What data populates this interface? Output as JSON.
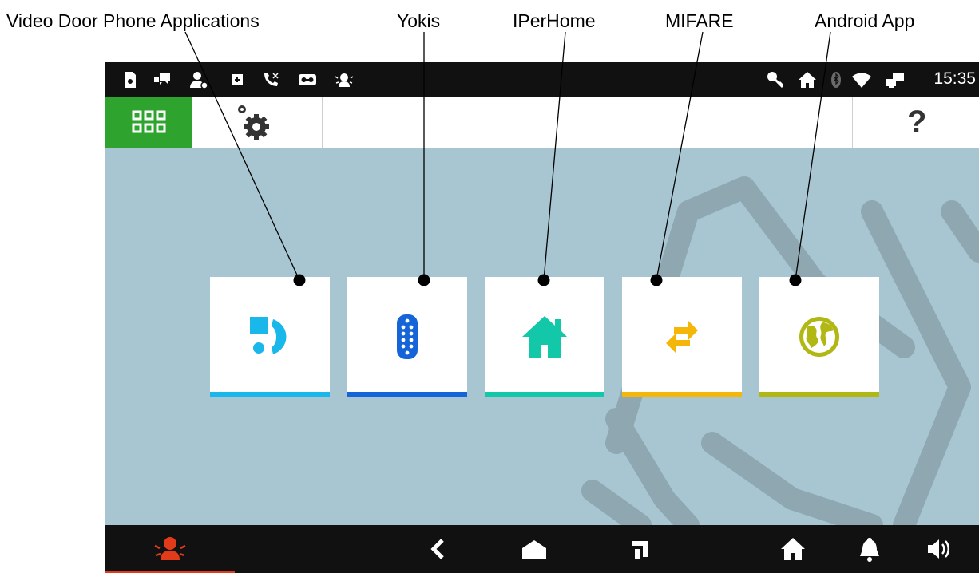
{
  "callouts": {
    "video_door_phone": "Video Door Phone Applications",
    "yokis": "Yokis",
    "iperhome": "IPerHome",
    "mifare": "MIFARE",
    "android_app": "Android App"
  },
  "status_bar": {
    "time": "15:35",
    "icons": [
      "sd-card-icon",
      "chat-icon",
      "user-forward-icon",
      "memo-icon",
      "missed-call-icon",
      "voicemail-icon",
      "alarm-person-icon",
      "key-icon",
      "home-icon",
      "bluetooth-icon",
      "wifi-icon",
      "network-icon"
    ]
  },
  "toolbar": {
    "apps_icon": "grid-icon",
    "settings_icon": "gear-icon",
    "help_label": "?"
  },
  "tiles": [
    {
      "name": "video-door-phone",
      "icon": "intercom-icon",
      "accent": "#1ab7ea"
    },
    {
      "name": "yokis",
      "icon": "remote-control-icon",
      "accent": "#1565d8"
    },
    {
      "name": "iperhome",
      "icon": "house-icon",
      "accent": "#13c7a9"
    },
    {
      "name": "mifare",
      "icon": "swap-arrows-icon",
      "accent": "#f5b60a"
    },
    {
      "name": "android-app",
      "icon": "globe-icon",
      "accent": "#b1b814"
    }
  ],
  "nav_bar": {
    "icons": [
      "alarm-icon",
      "back-icon",
      "home-nav-icon",
      "recent-apps-icon",
      "home-icon",
      "bell-icon",
      "volume-icon"
    ],
    "alarm_color": "#e23b19"
  },
  "colors": {
    "screen_bg": "#a8c6d2",
    "active_green": "#2ea32e"
  }
}
